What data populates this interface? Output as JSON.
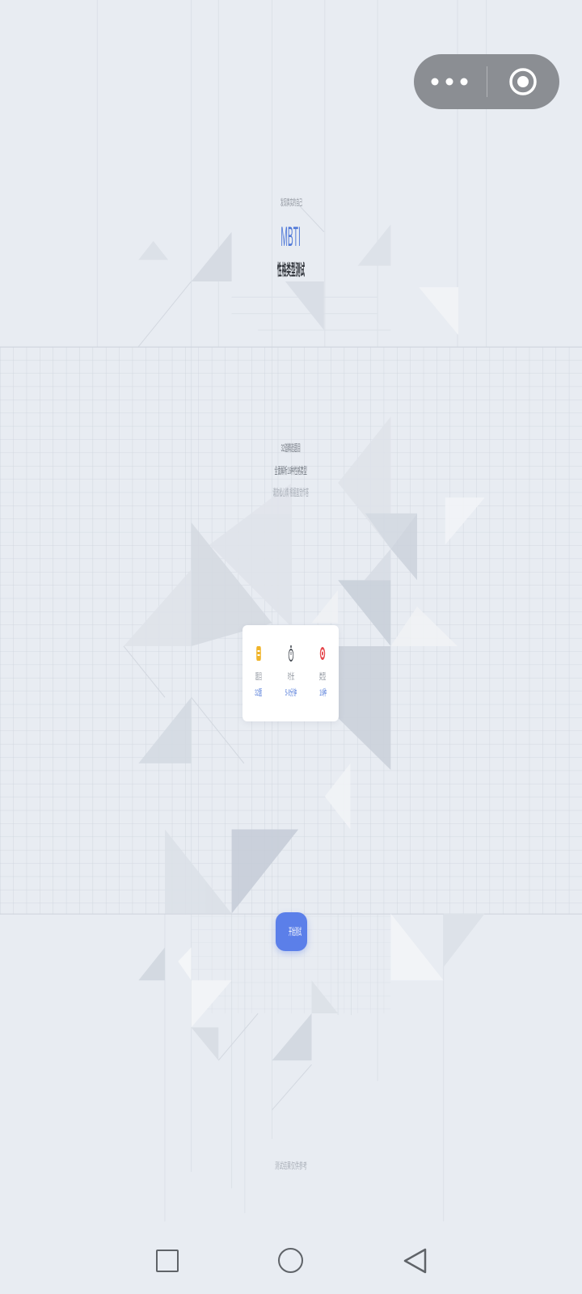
{
  "capsule": {
    "more_icon": "more-dots-icon",
    "exit_icon": "target-icon"
  },
  "header": {
    "subtitle": "发现真实的自己",
    "title": "MBTI",
    "heading": "性格类型测试"
  },
  "intro": {
    "lines": [
      "32道精选题目",
      "全面解析16种性格类型",
      "请放松心情 根据直觉作答"
    ]
  },
  "stats": [
    {
      "icon": "clipboard-icon",
      "label": "题目",
      "value": "32题"
    },
    {
      "icon": "timer-icon",
      "label": "时长",
      "value": "5-8分钟"
    },
    {
      "icon": "target-icon",
      "label": "类型",
      "value": "16种"
    }
  ],
  "start_button": {
    "label": "开始测试"
  },
  "footer": {
    "note": "测试结果仅供参考"
  },
  "nav": {
    "recents_icon": "square-icon",
    "home_icon": "circle-icon",
    "back_icon": "back-triangle-icon"
  },
  "theme": {
    "accent": "#4f78d8",
    "button": "#5b7fe9",
    "background": "#e8ecf2"
  }
}
